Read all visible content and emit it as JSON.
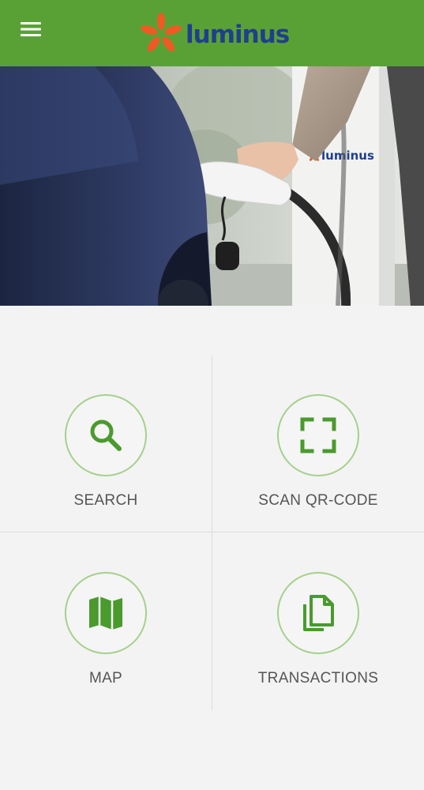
{
  "header": {
    "brand_name": "luminus",
    "menu_icon": "hamburger-menu-icon",
    "logo_icon": "luminus-star-logo-icon"
  },
  "hero": {
    "station_brand": "luminus"
  },
  "tiles": [
    {
      "label": "SEARCH",
      "icon": "search-icon"
    },
    {
      "label": "SCAN QR-CODE",
      "icon": "qr-scan-icon"
    },
    {
      "label": "MAP",
      "icon": "map-icon"
    },
    {
      "label": "TRANSACTIONS",
      "icon": "documents-icon"
    }
  ],
  "colors": {
    "app_bar": "#5aa135",
    "brand_orange": "#ef5a24",
    "brand_navy": "#1f3f8e",
    "icon_green": "#4a9a2e",
    "circle_border": "#a6d08c",
    "label_gray": "#555555",
    "background": "#f3f3f3"
  }
}
